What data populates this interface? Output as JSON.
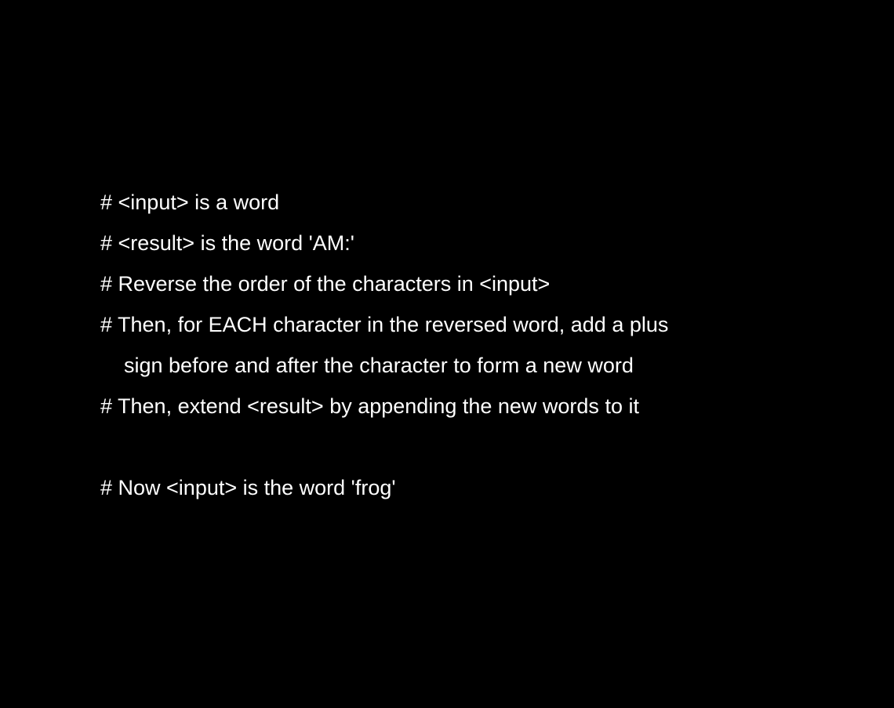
{
  "lines": [
    "# <input> is a word",
    "# <result> is the word 'AM:'",
    "# Reverse the order of the characters in <input>",
    "# Then, for EACH character in the reversed word, add a plus",
    "sign before and after the character to form a new word",
    "# Then, extend <result> by appending the new words to it",
    "",
    "# Now <input> is the word 'frog'"
  ]
}
